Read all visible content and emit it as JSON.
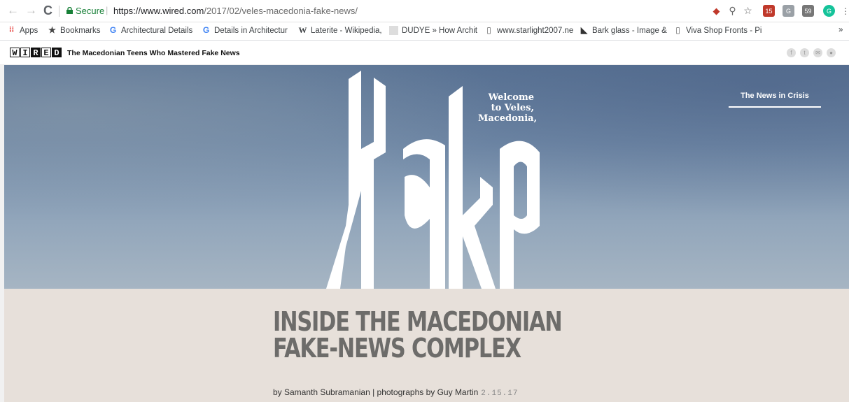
{
  "browser": {
    "back_glyph": "←",
    "forward_glyph": "→",
    "reload_glyph": "C",
    "secure_label": "Secure",
    "url_host": "https://www.wired.com",
    "url_path": "/2017/02/veles-macedonia-fake-news/",
    "extension_badges": [
      "15",
      "59"
    ],
    "extension_icons": [
      "translate-icon",
      "zoom-icon",
      "star-icon",
      "abp-icon",
      "ghost-icon",
      "chat-icon",
      "grammarly-icon"
    ]
  },
  "bookmarks": {
    "items": [
      {
        "label": "Apps",
        "icon": "apps-grid-icon"
      },
      {
        "label": "Bookmarks",
        "icon": "star-icon"
      },
      {
        "label": "Architectural Details",
        "icon": "google-icon"
      },
      {
        "label": "Details in Architectur",
        "icon": "google-icon"
      },
      {
        "label": "Laterite - Wikipedia,",
        "icon": "wikipedia-icon"
      },
      {
        "label": "DUDYE » How Archit",
        "icon": "page-icon"
      },
      {
        "label": "www.starlight2007.ne",
        "icon": "doc-icon"
      },
      {
        "label": "Bark glass - Image &",
        "icon": "bird-icon"
      },
      {
        "label": "Viva Shop Fronts - Pi",
        "icon": "doc-icon"
      }
    ],
    "overflow": "»"
  },
  "wired": {
    "logo_letters": [
      "W",
      "I",
      "R",
      "E",
      "D"
    ],
    "article_title": "The Macedonian Teens Who Mastered Fake News",
    "share_icons": [
      "f",
      "t",
      "✉",
      "●"
    ]
  },
  "hero": {
    "welcome_text": "Welcome to Veles, Macedonia,",
    "fake_word": "Fake",
    "section_link": "The News in Crisis"
  },
  "article": {
    "headline_line1": "INSIDE THE MACEDONIAN",
    "headline_line2": "FAKE-NEWS COMPLEX",
    "byline": "by Samanth Subramanian | photographs by Guy Martin",
    "date": "2.15.17"
  },
  "colors": {
    "secure_green": "#188038",
    "hero_sky": "#7089a7",
    "content_bg": "#e7e0da",
    "headline": "#6d6c6a"
  }
}
